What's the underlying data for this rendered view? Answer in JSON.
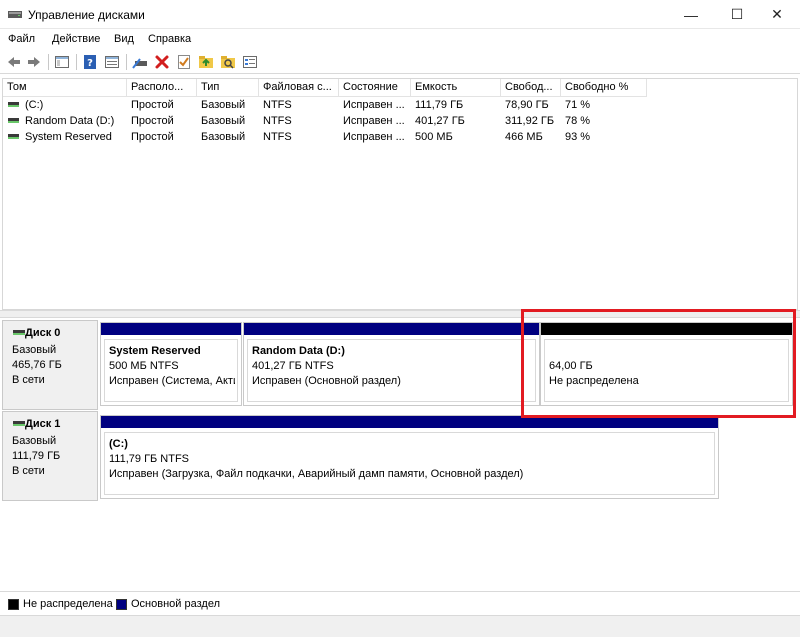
{
  "window": {
    "title": "Управление дисками",
    "controls": {
      "minimize": "—",
      "maximize": "☐",
      "close": "✕"
    }
  },
  "menu": [
    "Файл",
    "Действие",
    "Вид",
    "Справка"
  ],
  "toolbar": {
    "icons": [
      "back-arrow-icon",
      "forward-arrow-icon",
      "console-tree-icon",
      "help-icon",
      "properties-icon",
      "connect-drive-icon",
      "delete-icon",
      "check-icon",
      "up-folder-icon",
      "search-folder-icon",
      "view-list-icon"
    ]
  },
  "volumes": {
    "columns": [
      "Том",
      "Располо...",
      "Тип",
      "Файловая с...",
      "Состояние",
      "Емкость",
      "Свобод...",
      "Свободно %"
    ],
    "rows": [
      [
        "(C:)",
        "Простой",
        "Базовый",
        "NTFS",
        "Исправен ...",
        "111,79 ГБ",
        "78,90 ГБ",
        "71 %"
      ],
      [
        "Random Data (D:)",
        "Простой",
        "Базовый",
        "NTFS",
        "Исправен ...",
        "401,27 ГБ",
        "311,92 ГБ",
        "78 %"
      ],
      [
        "System Reserved",
        "Простой",
        "Базовый",
        "NTFS",
        "Исправен ...",
        "500 МБ",
        "466 МБ",
        "93 %"
      ]
    ]
  },
  "disks": [
    {
      "name": "Диск 0",
      "type": "Базовый",
      "size": "465,76 ГБ",
      "status": "В сети",
      "partitions": [
        {
          "name": "System Reserved",
          "size": "500 МБ NTFS",
          "status": "Исправен (Система, Акти",
          "kind": "primary"
        },
        {
          "name": "Random Data  (D:)",
          "size": "401,27 ГБ NTFS",
          "status": "Исправен (Основной раздел)",
          "kind": "primary"
        },
        {
          "name": "",
          "size": "64,00 ГБ",
          "status": "Не распределена",
          "kind": "unallocated"
        }
      ]
    },
    {
      "name": "Диск 1",
      "type": "Базовый",
      "size": "111,79 ГБ",
      "status": "В сети",
      "partitions": [
        {
          "name": "(C:)",
          "size": "111,79 ГБ NTFS",
          "status": "Исправен (Загрузка, Файл подкачки, Аварийный дамп памяти, Основной раздел)",
          "kind": "primary"
        }
      ]
    }
  ],
  "legend": [
    {
      "label": "Не распределена",
      "color": "#000000"
    },
    {
      "label": "Основной раздел",
      "color": "#000080"
    }
  ],
  "colors": {
    "primary": "#000080",
    "unallocated": "#000000",
    "highlight": "#e21b22"
  }
}
